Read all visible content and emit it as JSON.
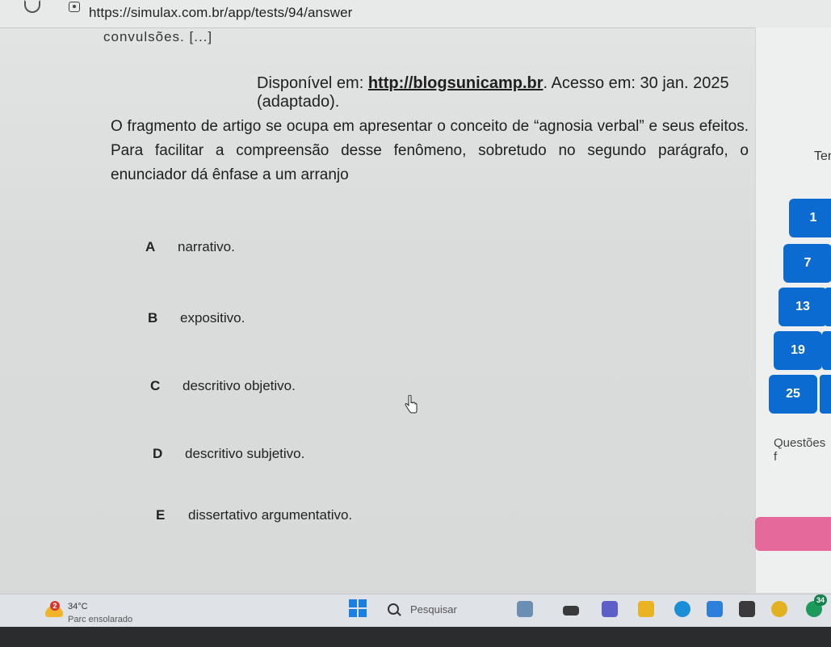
{
  "browser": {
    "url": "https://simulax.com.br/app/tests/94/answer"
  },
  "content": {
    "clipped_top": "convulsões. [...]",
    "source_prefix": "Disponível em: ",
    "source_link": "http://blogsunicamp.br",
    "source_suffix": ". Acesso em: 30 jan. 2025 (adaptado).",
    "question": "O fragmento de artigo se ocupa em apresentar o conceito de “agnosia verbal” e seus efeitos. Para facilitar a compreensão desse fenômeno, sobretudo no segundo parágrafo, o enunciador dá ênfase a um arranjo",
    "options": [
      {
        "letter": "A",
        "text": "narrativo."
      },
      {
        "letter": "B",
        "text": "expositivo."
      },
      {
        "letter": "C",
        "text": "descritivo objetivo."
      },
      {
        "letter": "D",
        "text": "descritivo subjetivo."
      },
      {
        "letter": "E",
        "text": "dissertativo argumentativo."
      }
    ]
  },
  "side_panel": {
    "label_top": "Ten",
    "question_numbers": [
      "1",
      "7",
      "13",
      "19",
      "25"
    ],
    "questoes_label": "Questões f"
  },
  "taskbar": {
    "weather_badge": "2",
    "temperature": "34°C",
    "weather_desc": "Parc ensolarado",
    "search_label": "Pesquisar",
    "tray_badge": "34"
  },
  "colors": {
    "accent_blue": "#0b6bd1",
    "pink_button": "#e5699a"
  }
}
